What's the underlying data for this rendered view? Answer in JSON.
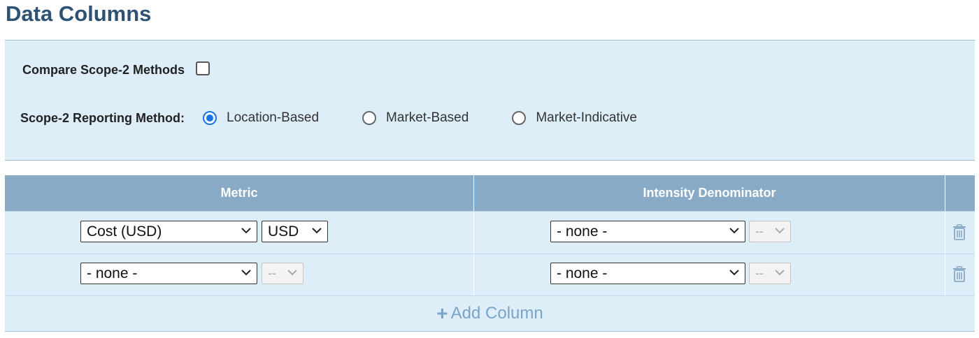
{
  "page": {
    "title": "Data Columns"
  },
  "options": {
    "compare_label": "Compare Scope-2 Methods",
    "compare_checked": false,
    "method_label": "Scope-2 Reporting Method:",
    "methods": [
      {
        "label": "Location-Based",
        "checked": true
      },
      {
        "label": "Market-Based",
        "checked": false
      },
      {
        "label": "Market-Indicative",
        "checked": false
      }
    ]
  },
  "table": {
    "headers": {
      "metric": "Metric",
      "denominator": "Intensity Denominator"
    },
    "rows": [
      {
        "metric": "Cost (USD)",
        "metric_unit": "USD",
        "metric_unit_disabled": false,
        "denominator": "- none -",
        "denominator_unit": "--",
        "denominator_unit_disabled": true
      },
      {
        "metric": "- none -",
        "metric_unit": "--",
        "metric_unit_disabled": true,
        "denominator": "- none -",
        "denominator_unit": "--",
        "denominator_unit_disabled": true
      }
    ],
    "add_label": "Add Column"
  },
  "icons": {
    "delete": "trash-icon",
    "add": "plus-icon",
    "dropdown": "chevron-down-icon"
  },
  "colors": {
    "title": "#2d5273",
    "panel_bg": "#ddeef9",
    "header_bg": "#88aac6",
    "radio_accent": "#1a73e8",
    "add_link": "#7ba3c6"
  }
}
